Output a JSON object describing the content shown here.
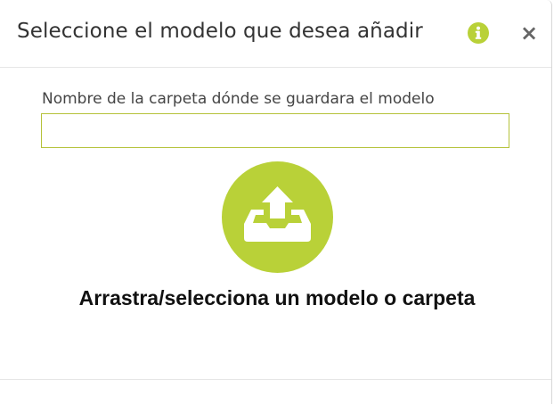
{
  "modal": {
    "title": "Seleccione el modelo que desea añadir",
    "info_icon": "info-circle-icon",
    "close_label": "×"
  },
  "form": {
    "folder_label": "Nombre de la carpeta dónde se guardara el modelo",
    "folder_value": "",
    "folder_placeholder": ""
  },
  "dropzone": {
    "icon": "upload-tray-icon",
    "text": "Arrastra/selecciona un modelo o carpeta"
  },
  "colors": {
    "accent": "#b9d138",
    "input_border": "#b5c23a",
    "title_text": "#333333"
  }
}
